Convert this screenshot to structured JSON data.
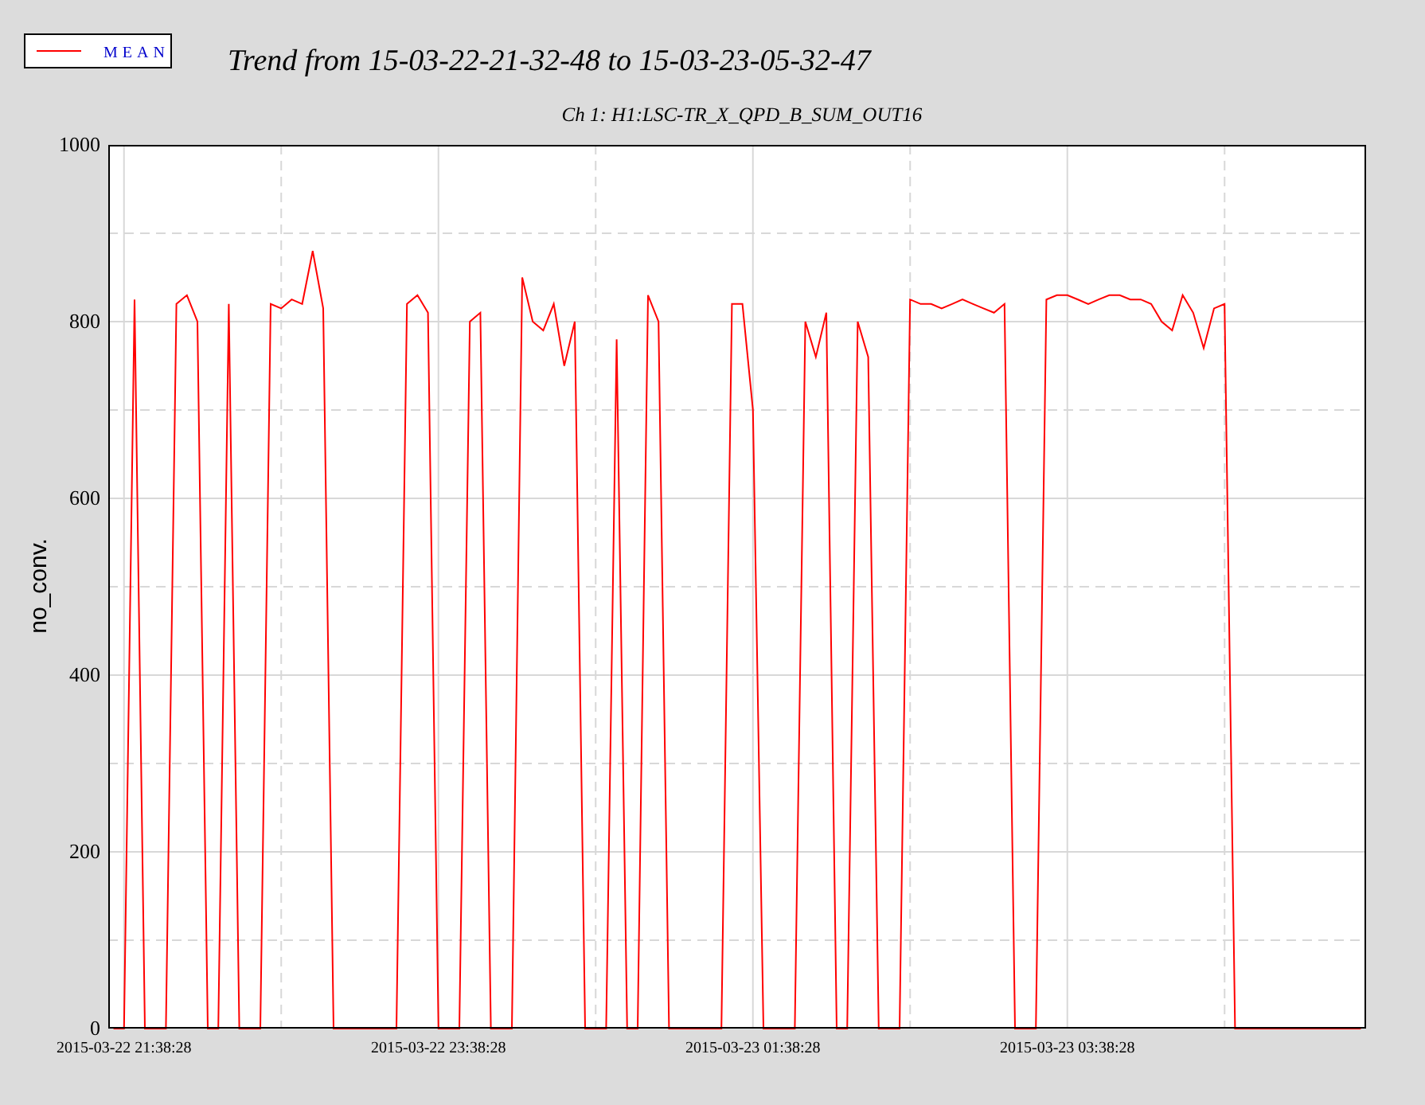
{
  "header_title": "Trend from 15-03-22-21-32-48 to 15-03-23-05-32-47",
  "chart_data": {
    "type": "line",
    "title": "Ch 1: H1:LSC-TR_X_QPD_B_SUM_OUT16",
    "ylabel": "no_conv.",
    "ylim": [
      0,
      1000
    ],
    "grid": true,
    "yticks": [
      0,
      200,
      400,
      600,
      800,
      1000
    ],
    "categories": [
      null,
      "2015-03-22 21:38:28",
      null,
      null,
      null,
      null,
      null,
      null,
      null,
      null,
      null,
      null,
      null,
      null,
      null,
      null,
      null,
      null,
      null,
      null,
      null,
      null,
      null,
      null,
      null,
      null,
      null,
      null,
      null,
      null,
      null,
      "2015-03-22 23:38:28",
      null,
      null,
      null,
      null,
      null,
      null,
      null,
      null,
      null,
      null,
      null,
      null,
      null,
      null,
      null,
      null,
      null,
      null,
      null,
      null,
      null,
      null,
      null,
      null,
      null,
      null,
      null,
      null,
      null,
      "2015-03-23 01:38:28",
      null,
      null,
      null,
      null,
      null,
      null,
      null,
      null,
      null,
      null,
      null,
      null,
      null,
      null,
      null,
      null,
      null,
      null,
      null,
      null,
      null,
      null,
      null,
      null,
      null,
      null,
      null,
      null,
      null,
      "2015-03-23 03:38:28",
      null,
      null,
      null,
      null,
      null,
      null,
      null,
      null,
      null,
      null,
      null,
      null,
      null,
      null,
      null,
      null,
      null,
      null,
      null,
      null,
      null,
      null,
      null,
      null,
      null,
      null,
      null,
      null
    ],
    "series": [
      {
        "name": "MEAN",
        "color": "#ff0000",
        "values": [
          0,
          0,
          825,
          0,
          0,
          0,
          820,
          830,
          800,
          0,
          0,
          820,
          0,
          0,
          0,
          820,
          815,
          825,
          820,
          880,
          815,
          0,
          0,
          0,
          0,
          0,
          0,
          0,
          820,
          830,
          810,
          0,
          0,
          0,
          800,
          810,
          0,
          0,
          0,
          850,
          800,
          790,
          820,
          750,
          800,
          0,
          0,
          0,
          780,
          0,
          0,
          830,
          800,
          0,
          0,
          0,
          0,
          0,
          0,
          820,
          820,
          700,
          0,
          0,
          0,
          0,
          800,
          760,
          810,
          0,
          0,
          800,
          760,
          0,
          0,
          0,
          825,
          820,
          820,
          815,
          820,
          825,
          820,
          815,
          810,
          820,
          0,
          0,
          0,
          825,
          830,
          830,
          825,
          820,
          825,
          830,
          830,
          825,
          825,
          820,
          800,
          790,
          830,
          810,
          770,
          815,
          820,
          0,
          0,
          0,
          0,
          0,
          0,
          0,
          0,
          0,
          0,
          0,
          0,
          0
        ]
      }
    ]
  }
}
